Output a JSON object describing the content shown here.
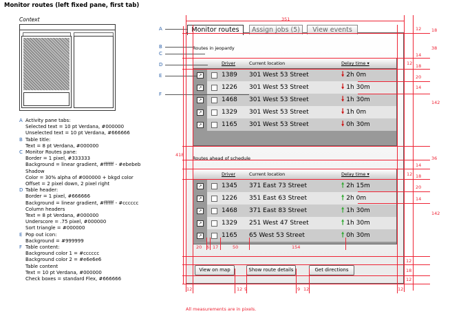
{
  "title": "Monitor routes (left fixed pane, first tab)",
  "context_label": "Context",
  "notes": [
    {
      "letter": "A",
      "lines": [
        "Activity pane tabs:",
        "Selected text = 10 pt Verdana, #000000",
        "Unselected text = 10 pt Verdana, #666666"
      ]
    },
    {
      "letter": "B",
      "lines": [
        "Table title:",
        "Text = 8 pt Verdana, #000000"
      ]
    },
    {
      "letter": "C",
      "lines": [
        "Monitor Routes pane:",
        "Border = 1 pixel, #333333",
        "Background = linear gradient, #ffffff - #ebebeb",
        "Shadow",
        "Color = 30% alpha of #000000 + bkgd color",
        "Offset = 2 pixel down, 2 pixel right"
      ]
    },
    {
      "letter": "D",
      "lines": [
        "Table header:",
        "Border = 1 pixel, #666666",
        "Background = linear gradient, #ffffff - #cccccc",
        "Column headers",
        "Text = 8 pt Verdana, #000000",
        "Underscore = .75 pixel, #000000",
        "Sort triangle = #000000"
      ]
    },
    {
      "letter": "E",
      "lines": [
        "Pop out icon:",
        "Background = #999999"
      ]
    },
    {
      "letter": "F",
      "lines": [
        "Table content:",
        "Background color 1 = #cccccc",
        "Background color 2 = #e6e6e6",
        "Table content",
        "Text = 10 pt Verdana, #000000",
        "Check boxes = standard Flex, #666666"
      ]
    }
  ],
  "tabs": [
    "Monitor routes",
    "Assign jobs (5)",
    "View events"
  ],
  "section1": {
    "title": "Routes in jeopardy",
    "headers": {
      "driver": "Driver",
      "location": "Current location",
      "delay": "Delay time ▾"
    },
    "rows": [
      {
        "driver": "1389",
        "location": "301 West 53 Street",
        "delay": "2h 0m"
      },
      {
        "driver": "1226",
        "location": "301 West 53 Street",
        "delay": "1h 30m"
      },
      {
        "driver": "1468",
        "location": "301 West 53 Street",
        "delay": "1h 30m"
      },
      {
        "driver": "1329",
        "location": "301 West 53 Street",
        "delay": "1h 0m"
      },
      {
        "driver": "1165",
        "location": "301 West 53 Street",
        "delay": "0h 30m"
      }
    ]
  },
  "section2": {
    "title": "Routes ahead of schedule",
    "headers": {
      "driver": "Driver",
      "location": "Current location",
      "delay": "Delay time ▾"
    },
    "rows": [
      {
        "driver": "1345",
        "location": "371 East 73 Street",
        "delay": "2h 15m"
      },
      {
        "driver": "1226",
        "location": "351 East 63 Street",
        "delay": "2h 0m"
      },
      {
        "driver": "1468",
        "location": "371 East 83 Street",
        "delay": "1h 30m"
      },
      {
        "driver": "1329",
        "location": "251 West 47 Street",
        "delay": "1h 30m"
      },
      {
        "driver": "1165",
        "location": "65 West 53 Street",
        "delay": "0h 30m"
      }
    ]
  },
  "buttons": [
    "View on map",
    "Show route details",
    "Get directions"
  ],
  "measurements": {
    "top_width": "351",
    "right1": "12",
    "right2": "18",
    "r38": "38",
    "r14a": "14",
    "r12a": "12",
    "r18a": "18",
    "r20a": "20",
    "r14b": "14",
    "r142a": "142",
    "r418": "418",
    "r36": "36",
    "r14c": "14",
    "r12b": "12",
    "r18b": "18",
    "r20b": "20",
    "r14d": "14",
    "r142b": "142",
    "col20": "20",
    "col6": "6",
    "col17": "17",
    "col50": "50",
    "col154": "154",
    "r12c": "12",
    "r18c": "18",
    "r12d": "12",
    "b12a": "12",
    "b12b": "12",
    "b9a": "9",
    "b9b": "9",
    "b12c": "12",
    "b12d": "12"
  },
  "footnote": "All measurements are in pixels."
}
